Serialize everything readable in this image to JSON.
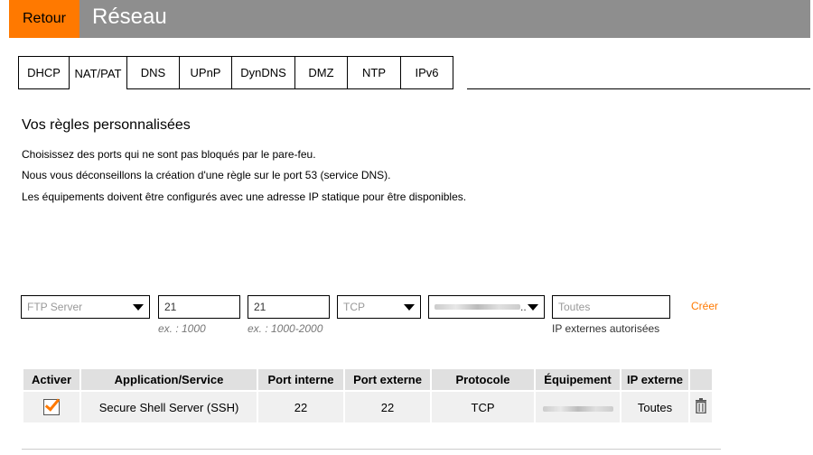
{
  "header": {
    "back_label": "Retour",
    "title": "Réseau"
  },
  "tabs": [
    {
      "label": "DHCP",
      "active": false
    },
    {
      "label": "NAT/PAT",
      "active": true
    },
    {
      "label": "DNS",
      "active": false
    },
    {
      "label": "UPnP",
      "active": false
    },
    {
      "label": "DynDNS",
      "active": false
    },
    {
      "label": "DMZ",
      "active": false
    },
    {
      "label": "NTP",
      "active": false
    },
    {
      "label": "IPv6",
      "active": false
    }
  ],
  "section": {
    "title": "Vos règles personnalisées",
    "lines": [
      "Choisissez des ports qui ne sont pas bloqués par le pare-feu.",
      "Nous vous déconseillons la création d'une règle sur le port 53 (service DNS).",
      "Les équipements doivent être configurés avec une adresse IP statique pour être disponibles."
    ]
  },
  "form": {
    "application_select": "FTP Server",
    "port_internal_value": "21",
    "port_internal_hint": "ex. : 1000",
    "port_external_value": "21",
    "port_external_hint": "ex. : 1000-2000",
    "protocol_select": "TCP",
    "device_select_suffix": "..",
    "external_ip_placeholder": "Toutes",
    "external_ip_hint": "IP externes autorisées",
    "create_label": "Créer"
  },
  "table": {
    "headers": [
      "Activer",
      "Application/Service",
      "Port interne",
      "Port externe",
      "Protocole",
      "Équipement",
      "IP externe"
    ],
    "rows": [
      {
        "enabled": true,
        "application": "Secure Shell Server (SSH)",
        "port_internal": "22",
        "port_external": "22",
        "protocol": "TCP",
        "ip_external": "Toutes"
      }
    ]
  },
  "colors": {
    "accent": "#ff7900",
    "header_bg": "#8e8e8e"
  },
  "icons": {
    "delete": "trash-icon",
    "dropdown": "chevron-down-icon"
  }
}
